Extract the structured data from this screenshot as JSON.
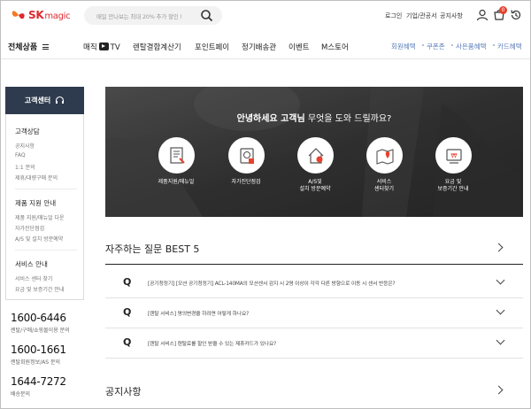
{
  "brand": {
    "name": "SK",
    "sub": "magic",
    "color": "#e0282e"
  },
  "search": {
    "placeholder": "매일 만나보는 최대 20% 추가 할인 !"
  },
  "util": {
    "login": "로그인",
    "corp": "기업/관공서",
    "notice": "공지사항",
    "cart_count": "0"
  },
  "gnb": {
    "all_menu": "전체상품",
    "items": [
      "매직",
      "TV",
      "렌탈결합계산기",
      "포인트페이",
      "정기배송관",
      "이벤트",
      "M스토어"
    ],
    "benefits": [
      "회원혜택",
      "쿠폰존",
      "사은품혜택",
      "카드혜택"
    ]
  },
  "sidebar": {
    "header": "고객센터",
    "sections": [
      {
        "title": "고객상담",
        "links": [
          "공지사항",
          "FAQ",
          "1:1 문의",
          "제휴/대량구매 문의"
        ]
      },
      {
        "title": "제품 지원 안내",
        "links": [
          "제품 지원/매뉴얼 다운",
          "자가진단점검",
          "A/S 및 설치 방문예약"
        ]
      },
      {
        "title": "서비스 안내",
        "links": [
          "서비스 센터 찾기",
          "요금 및 보증기간 안내"
        ]
      }
    ],
    "phones": [
      {
        "number": "1600-6446",
        "desc": "렌탈/구매/쇼핑몰이용 문의"
      },
      {
        "number": "1600-1661",
        "desc": "렌탈회원정보/AS 문의"
      },
      {
        "number": "1644-7272",
        "desc": "배송문의"
      }
    ]
  },
  "hero": {
    "title_bold": "안녕하세요 고객님",
    "title_rest": " 무엇을 도와 드릴까요?",
    "items": [
      {
        "label": "제품지원/매뉴얼",
        "label2": "",
        "icon": "manual-icon"
      },
      {
        "label": "자가진단점검",
        "label2": "",
        "icon": "self-check-icon"
      },
      {
        "label": "A/S및",
        "label2": "설치 방문예약",
        "icon": "house-icon"
      },
      {
        "label": "서비스",
        "label2": "센터찾기",
        "icon": "map-pin-icon"
      },
      {
        "label": "요금 및",
        "label2": "보증기간 안내",
        "icon": "price-icon"
      }
    ]
  },
  "faq": {
    "title": "자주하는 질문 BEST 5",
    "q_mark": "Q",
    "items": [
      "[공기청정기] [모션 공기청정기] ACL-140MA의 모션센서 감지 시 2명 이상이 각각 다른 방향으로 이동 시 센서 반응은?",
      "[렌탈 서비스] 명의변경을 하려면 어떻게 하나요?",
      "[렌탈 서비스] 렌탈료를 할인 받을 수 있는 제휴카드가 있나요?"
    ]
  },
  "notice": {
    "title": "공지사항"
  }
}
